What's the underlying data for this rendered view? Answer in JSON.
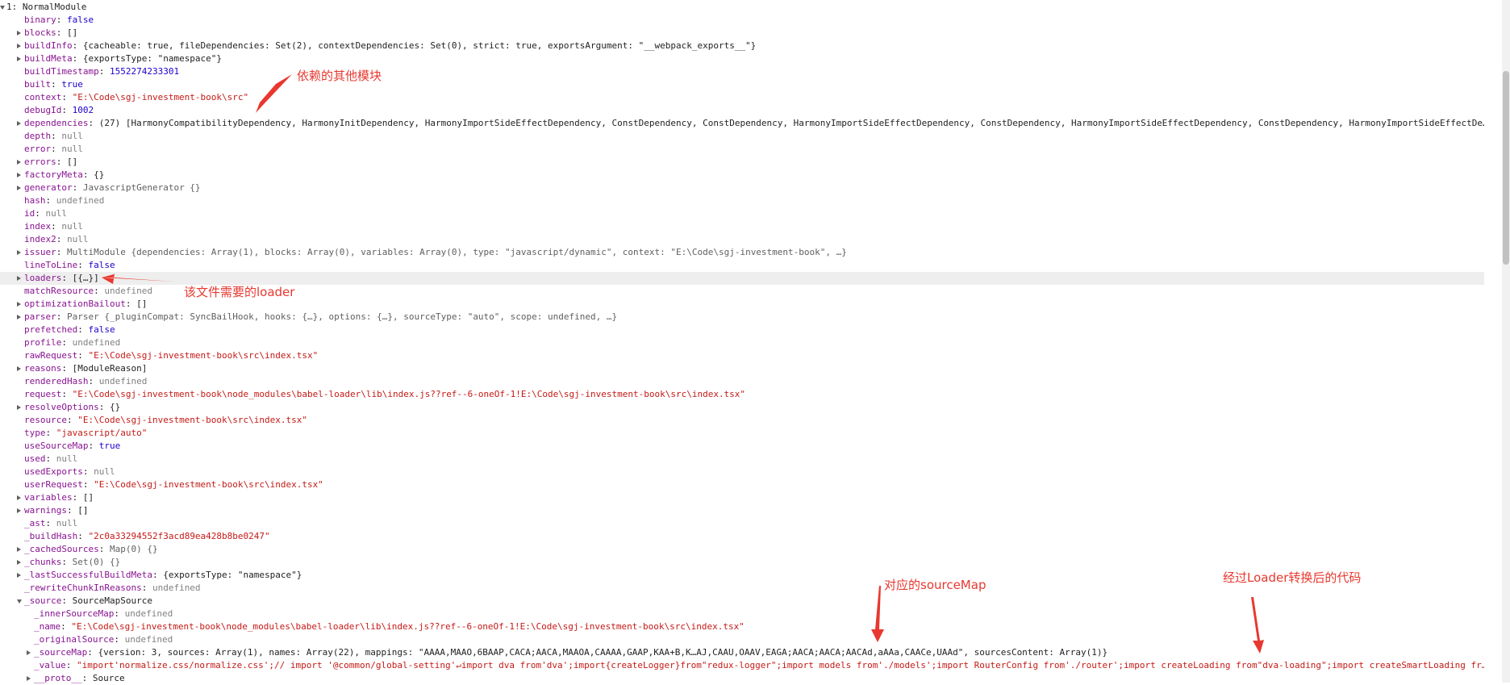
{
  "root": {
    "index": "1",
    "type": "NormalModule"
  },
  "rows": [
    {
      "indent": 0,
      "toggle": "open",
      "key": "▾1",
      "sep": ": ",
      "value": "NormalModule",
      "vt": "obj",
      "keyPlain": true
    },
    {
      "indent": 1,
      "toggle": "none",
      "key": "binary",
      "value": "false",
      "vt": "bool"
    },
    {
      "indent": 1,
      "toggle": "closed",
      "key": "blocks",
      "value": "[]",
      "vt": "obj"
    },
    {
      "indent": 1,
      "toggle": "closed",
      "key": "buildInfo",
      "value": "{cacheable: true, fileDependencies: Set(2), contextDependencies: Set(0), strict: true, exportsArgument: \"__webpack_exports__\"}",
      "vt": "obj"
    },
    {
      "indent": 1,
      "toggle": "closed",
      "key": "buildMeta",
      "value": "{exportsType: \"namespace\"}",
      "vt": "obj"
    },
    {
      "indent": 1,
      "toggle": "none",
      "key": "buildTimestamp",
      "value": "1552274233301",
      "vt": "num"
    },
    {
      "indent": 1,
      "toggle": "none",
      "key": "built",
      "value": "true",
      "vt": "bool"
    },
    {
      "indent": 1,
      "toggle": "none",
      "key": "context",
      "value": "\"E:\\Code\\sgj-investment-book\\src\"",
      "vt": "str"
    },
    {
      "indent": 1,
      "toggle": "none",
      "key": "debugId",
      "value": "1002",
      "vt": "num"
    },
    {
      "indent": 1,
      "toggle": "closed",
      "key": "dependencies",
      "value": "(27) [HarmonyCompatibilityDependency, HarmonyInitDependency, HarmonyImportSideEffectDependency, ConstDependency, ConstDependency, HarmonyImportSideEffectDependency, ConstDependency, HarmonyImportSideEffectDependency, ConstDependency, HarmonyImportSideEffectDe…",
      "vt": "obj"
    },
    {
      "indent": 1,
      "toggle": "none",
      "key": "depth",
      "value": "null",
      "vt": "nul"
    },
    {
      "indent": 1,
      "toggle": "none",
      "key": "error",
      "value": "null",
      "vt": "nul"
    },
    {
      "indent": 1,
      "toggle": "closed",
      "key": "errors",
      "value": "[]",
      "vt": "obj"
    },
    {
      "indent": 1,
      "toggle": "closed",
      "key": "factoryMeta",
      "value": "{}",
      "vt": "obj"
    },
    {
      "indent": 1,
      "toggle": "closed",
      "key": "generator",
      "value": "JavascriptGenerator {}",
      "vt": "gray"
    },
    {
      "indent": 1,
      "toggle": "none",
      "key": "hash",
      "value": "undefined",
      "vt": "nul"
    },
    {
      "indent": 1,
      "toggle": "none",
      "key": "id",
      "value": "null",
      "vt": "nul"
    },
    {
      "indent": 1,
      "toggle": "none",
      "key": "index",
      "value": "null",
      "vt": "nul"
    },
    {
      "indent": 1,
      "toggle": "none",
      "key": "index2",
      "value": "null",
      "vt": "nul"
    },
    {
      "indent": 1,
      "toggle": "closed",
      "key": "issuer",
      "value": "MultiModule {dependencies: Array(1), blocks: Array(0), variables: Array(0), type: \"javascript/dynamic\", context: \"E:\\Code\\sgj-investment-book\", …}",
      "vt": "gray"
    },
    {
      "indent": 1,
      "toggle": "none",
      "key": "lineToLine",
      "value": "false",
      "vt": "bool"
    },
    {
      "indent": 1,
      "toggle": "closed",
      "key": "loaders",
      "value": "[{…}]",
      "vt": "obj",
      "highlight": true
    },
    {
      "indent": 1,
      "toggle": "none",
      "key": "matchResource",
      "value": "undefined",
      "vt": "nul"
    },
    {
      "indent": 1,
      "toggle": "closed",
      "key": "optimizationBailout",
      "value": "[]",
      "vt": "obj"
    },
    {
      "indent": 1,
      "toggle": "closed",
      "key": "parser",
      "value": "Parser {_pluginCompat: SyncBailHook, hooks: {…}, options: {…}, sourceType: \"auto\", scope: undefined, …}",
      "vt": "gray"
    },
    {
      "indent": 1,
      "toggle": "none",
      "key": "prefetched",
      "value": "false",
      "vt": "bool"
    },
    {
      "indent": 1,
      "toggle": "none",
      "key": "profile",
      "value": "undefined",
      "vt": "nul"
    },
    {
      "indent": 1,
      "toggle": "none",
      "key": "rawRequest",
      "value": "\"E:\\Code\\sgj-investment-book\\src\\index.tsx\"",
      "vt": "str"
    },
    {
      "indent": 1,
      "toggle": "closed",
      "key": "reasons",
      "value": "[ModuleReason]",
      "vt": "obj"
    },
    {
      "indent": 1,
      "toggle": "none",
      "key": "renderedHash",
      "value": "undefined",
      "vt": "nul"
    },
    {
      "indent": 1,
      "toggle": "none",
      "key": "request",
      "value": "\"E:\\Code\\sgj-investment-book\\node_modules\\babel-loader\\lib\\index.js??ref--6-oneOf-1!E:\\Code\\sgj-investment-book\\src\\index.tsx\"",
      "vt": "str"
    },
    {
      "indent": 1,
      "toggle": "closed",
      "key": "resolveOptions",
      "value": "{}",
      "vt": "obj"
    },
    {
      "indent": 1,
      "toggle": "none",
      "key": "resource",
      "value": "\"E:\\Code\\sgj-investment-book\\src\\index.tsx\"",
      "vt": "str"
    },
    {
      "indent": 1,
      "toggle": "none",
      "key": "type",
      "value": "\"javascript/auto\"",
      "vt": "str"
    },
    {
      "indent": 1,
      "toggle": "none",
      "key": "useSourceMap",
      "value": "true",
      "vt": "bool"
    },
    {
      "indent": 1,
      "toggle": "none",
      "key": "used",
      "value": "null",
      "vt": "nul"
    },
    {
      "indent": 1,
      "toggle": "none",
      "key": "usedExports",
      "value": "null",
      "vt": "nul"
    },
    {
      "indent": 1,
      "toggle": "none",
      "key": "userRequest",
      "value": "\"E:\\Code\\sgj-investment-book\\src\\index.tsx\"",
      "vt": "str"
    },
    {
      "indent": 1,
      "toggle": "closed",
      "key": "variables",
      "value": "[]",
      "vt": "obj"
    },
    {
      "indent": 1,
      "toggle": "closed",
      "key": "warnings",
      "value": "[]",
      "vt": "obj"
    },
    {
      "indent": 1,
      "toggle": "none",
      "key": "_ast",
      "value": "null",
      "vt": "nul"
    },
    {
      "indent": 1,
      "toggle": "none",
      "key": "_buildHash",
      "value": "\"2c0a33294552f3acd89ea428b8be0247\"",
      "vt": "str"
    },
    {
      "indent": 1,
      "toggle": "closed",
      "key": "_cachedSources",
      "value": "Map(0) {}",
      "vt": "gray"
    },
    {
      "indent": 1,
      "toggle": "closed",
      "key": "_chunks",
      "value": "Set(0) {}",
      "vt": "gray"
    },
    {
      "indent": 1,
      "toggle": "closed",
      "key": "_lastSuccessfulBuildMeta",
      "value": "{exportsType: \"namespace\"}",
      "vt": "obj"
    },
    {
      "indent": 1,
      "toggle": "none",
      "key": "_rewriteChunkInReasons",
      "value": "undefined",
      "vt": "nul"
    },
    {
      "indent": 1,
      "toggle": "open",
      "key": "_source",
      "value": "SourceMapSource",
      "vt": "obj"
    },
    {
      "indent": 2,
      "toggle": "none",
      "key": "_innerSourceMap",
      "value": "undefined",
      "vt": "nul"
    },
    {
      "indent": 2,
      "toggle": "none",
      "key": "_name",
      "value": "\"E:\\Code\\sgj-investment-book\\node_modules\\babel-loader\\lib\\index.js??ref--6-oneOf-1!E:\\Code\\sgj-investment-book\\src\\index.tsx\"",
      "vt": "str"
    },
    {
      "indent": 2,
      "toggle": "none",
      "key": "_originalSource",
      "value": "undefined",
      "vt": "nul"
    },
    {
      "indent": 2,
      "toggle": "closed",
      "key": "_sourceMap",
      "value": "{version: 3, sources: Array(1), names: Array(22), mappings: \"AAAA,MAAO,6BAAP,CACA;AACA,MAAOA,CAAAA,GAAP,KAA+B,K…AJ,CAAU,OAAV,EAGA;AACA;AACA;AACAd,aAAa,CAACe,UAAd\", sourcesContent: Array(1)}",
      "vt": "obj"
    },
    {
      "indent": 2,
      "toggle": "none",
      "key": "_value",
      "value": "\"import'normalize.css/normalize.css';// import '@common/global-setting'↵import dva from'dva';import{createLogger}from\"redux-logger\";import models from'./models';import RouterConfig from'./router';import createLoading from\"dva-loading\";import createSmartLoading fr…",
      "vt": "str"
    },
    {
      "indent": 2,
      "toggle": "closed",
      "key": "__proto__",
      "value": "Source",
      "vt": "obj"
    }
  ],
  "annotations": {
    "dependencies_note": "依赖的其他模块",
    "loaders_note": "该文件需要的loader",
    "sourcemap_note": "对应的sourceMap",
    "value_note": "经过Loader转换后的代码"
  },
  "colors": {
    "key": "#881391",
    "string": "#c41a16",
    "number": "#1c00cf",
    "null": "#808080",
    "annotation": "#e8382f",
    "highlight": "#eeeeee"
  }
}
